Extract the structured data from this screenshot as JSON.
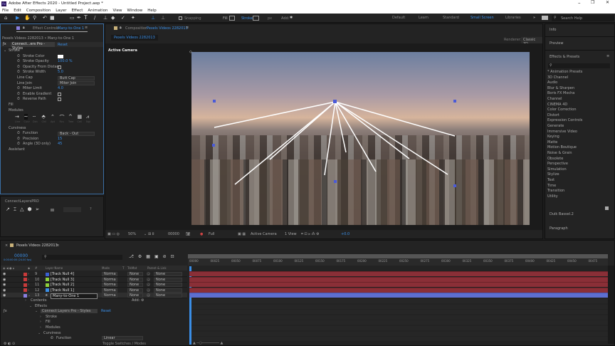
{
  "app": {
    "title": "Adobe After Effects 2020 - Untitled Project.aep *",
    "logo": "Ae"
  },
  "menu": [
    "File",
    "Edit",
    "Composition",
    "Layer",
    "Effect",
    "Animation",
    "View",
    "Window",
    "Help"
  ],
  "toolbar": {
    "snapping": "Snapping",
    "fill": "Fill",
    "stroke": "Stroke",
    "stroke_px": "px",
    "add": "Add:",
    "workspaces": [
      "Default",
      "Learn",
      "Standard",
      "Small Screen",
      "Libraries"
    ],
    "active_workspace": "Small Screen",
    "search_placeholder": "Search Help"
  },
  "effect_controls": {
    "tab": "Effect Controls",
    "tab_layer": "Many-to-One 1",
    "subtitle": "Pexels Videos 2282013 • Many-to-One 1",
    "effect_name": "Connect...ers Pro - Styles",
    "reset": "Reset",
    "stroke_group": "Stroke",
    "props": [
      {
        "label": "Stroke Color",
        "type": "color"
      },
      {
        "label": "Stroke Opacity",
        "value": "100.0 %"
      },
      {
        "label": "Opacity From Distan",
        "type": "check"
      },
      {
        "label": "Stroke Width",
        "value": "5.0"
      },
      {
        "label": "Line Cap",
        "value": "Butt Cap",
        "type": "dropdown"
      },
      {
        "label": "Line Join",
        "value": "Miter Join",
        "type": "dropdown"
      },
      {
        "label": "Miter Limit",
        "value": "4.0"
      },
      {
        "label": "Enable Gradient",
        "type": "check"
      },
      {
        "label": "Reverse Path",
        "type": "check"
      }
    ],
    "fill_group": "Fill",
    "modules_group": "Modules",
    "modules": [
      "Line",
      "Curv",
      "Dsh",
      "Chil",
      "Apt",
      "Rcs",
      "Tree",
      "Cell",
      "Ngl"
    ],
    "curviness_group": "Curviness",
    "curviness": [
      {
        "label": "Function",
        "value": "Back - Out",
        "type": "dropdown"
      },
      {
        "label": "Precision",
        "value": "15"
      },
      {
        "label": "Angle (3D only)",
        "value": "45"
      }
    ],
    "assistant": "Assistant"
  },
  "connect_panel": {
    "title": "ConnectLayersPRO",
    "help": "?"
  },
  "composition": {
    "tab": "Composition",
    "tab_name": "Pexels Videos 2282013",
    "subtab": "Pexels Videos 2282013",
    "renderer_label": "Renderer:",
    "renderer": "Classic 3D",
    "camera_label": "Active Camera",
    "footer": {
      "zoom": "50%",
      "timecode": "00000",
      "resolution": "Full",
      "camera": "Active Camera",
      "view": "1 View",
      "exposure": "+0.0"
    }
  },
  "right_panel": {
    "info": "Info",
    "preview": "Preview",
    "effects_presets": "Effects & Presets",
    "categories": [
      "* Animation Presets",
      "3D Channel",
      "Audio",
      "Blur & Sharpen",
      "Boris FX Mocha",
      "Channel",
      "CINEMA 4D",
      "Color Correction",
      "Distort",
      "Expression Controls",
      "Generate",
      "Immersive Video",
      "Keying",
      "Matte",
      "Motion Boutique",
      "Noise & Grain",
      "Obsolete",
      "Perspective",
      "Simulation",
      "Stylize",
      "Text",
      "Time",
      "Transition",
      "Utility"
    ],
    "duik": "Duik Bassel.2",
    "paragraph": "Paragraph"
  },
  "timeline": {
    "tab": "Pexels Videos 2282013",
    "timecode": "00000",
    "fps": "0:00:00:00 (24.00 fps)",
    "headers": {
      "num": "#",
      "layer_name": "Layer Name",
      "mode": "Mode",
      "t": "T",
      "trkmat": "TrkMat",
      "parent": "Parent & Link"
    },
    "layers": [
      {
        "num": "9",
        "name": "[Track Null 4]",
        "color": "#3a5fd0",
        "mode": "Norma",
        "trkmat": "None",
        "parent": "None"
      },
      {
        "num": "10",
        "name": "[Track Null 3]",
        "color": "#8ed13a",
        "mode": "Norma",
        "trkmat": "None",
        "parent": "None"
      },
      {
        "num": "11",
        "name": "[Track Null 2]",
        "color": "#8ed13a",
        "mode": "Norma",
        "trkmat": "None",
        "parent": "None"
      },
      {
        "num": "12",
        "name": "[Track Null 1]",
        "color": "#3a8ee6",
        "mode": "Norma",
        "trkmat": "None",
        "parent": "None"
      },
      {
        "num": "13",
        "name": "Many-to-One 1",
        "color": "#8a7fe0",
        "mode": "Norma",
        "trkmat": "None",
        "parent": "None"
      }
    ],
    "contents": "Contents",
    "add": "Add:",
    "effects": "Effects",
    "effect": "Connect Layers Pro - Styles",
    "reset": "Reset",
    "stroke": "Stroke",
    "fill": "Fill",
    "modules": "Modules",
    "curviness": "Curviness",
    "function": "Function",
    "function_value": "Linear",
    "toggle": "Toggle Switches / Modes",
    "ruler": [
      "00000",
      "00025",
      "00050",
      "00075",
      "00100",
      "00125",
      "00150",
      "00175",
      "00200",
      "00225",
      "00250",
      "00275",
      "00300",
      "00325",
      "00350",
      "00375",
      "00400",
      "00425",
      "00450",
      "00475"
    ]
  }
}
